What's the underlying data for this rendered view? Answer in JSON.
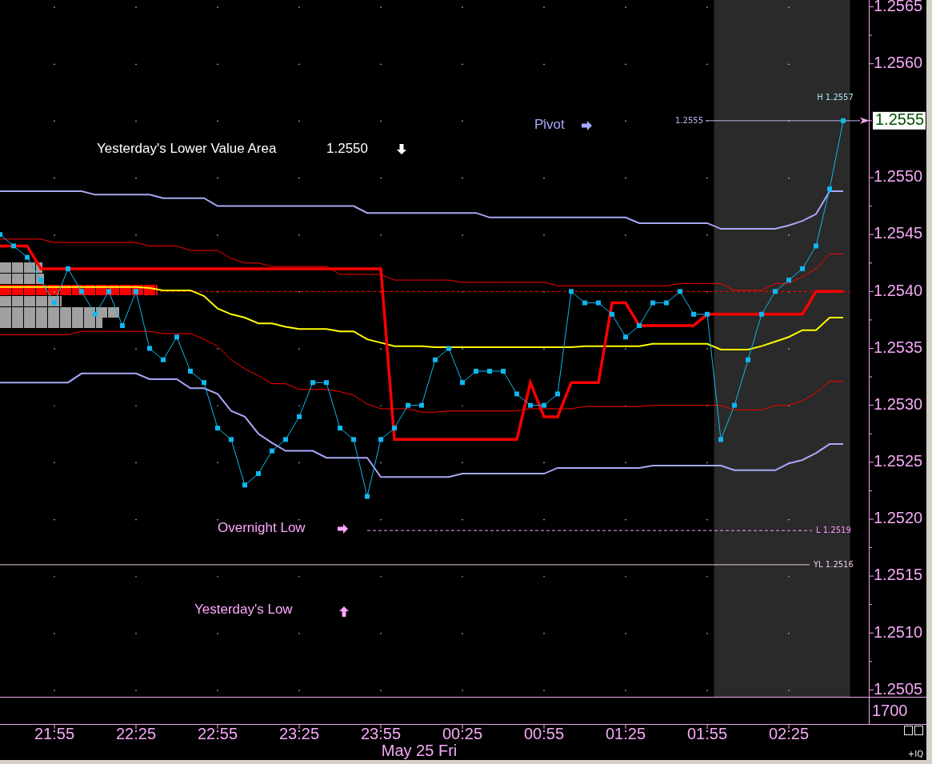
{
  "chart": {
    "chart_data": {
      "type": "line",
      "categories": [
        null,
        null,
        null,
        null,
        "21:55",
        null,
        null,
        null,
        null,
        null,
        "22:25",
        null,
        null,
        null,
        null,
        null,
        "22:55",
        null,
        null,
        null,
        null,
        null,
        "23:25",
        null,
        null,
        null,
        null,
        null,
        "23:55",
        null,
        null,
        null,
        null,
        null,
        "00:25",
        null,
        null,
        null,
        null,
        null,
        "00:55",
        null,
        null,
        null,
        null,
        null,
        "01:25",
        null,
        null,
        null,
        null,
        null,
        "01:55",
        null,
        null,
        null,
        null,
        null,
        "02:25",
        null,
        null,
        null,
        null
      ],
      "ylim": [
        1.25044,
        1.25656
      ],
      "grid": true,
      "yticks": [
        {
          "value": 1.2565,
          "label": "1.2565"
        },
        {
          "value": 1.256,
          "label": "1.2560"
        },
        {
          "value": 1.255,
          "label": "1.2550"
        },
        {
          "value": 1.2545,
          "label": "1.2545"
        },
        {
          "value": 1.254,
          "label": "1.2540"
        },
        {
          "value": 1.2535,
          "label": "1.2535"
        },
        {
          "value": 1.253,
          "label": "1.2530"
        },
        {
          "value": 1.2525,
          "label": "1.2525"
        },
        {
          "value": 1.252,
          "label": "1.2520"
        },
        {
          "value": 1.2515,
          "label": "1.2515"
        },
        {
          "value": 1.251,
          "label": "1.2510"
        },
        {
          "value": 1.2505,
          "label": "1.2505"
        }
      ],
      "series": [
        {
          "color": "#a8a8f8",
          "values": [
            1.25488,
            1.25488,
            1.25488,
            1.25488,
            1.25488,
            1.25488,
            1.25488,
            1.25485,
            1.25485,
            1.25485,
            1.25485,
            1.25485,
            1.25482,
            1.25482,
            1.25482,
            1.25482,
            1.25475,
            1.25475,
            1.25475,
            1.25475,
            1.25475,
            1.25475,
            1.25475,
            1.25475,
            1.25475,
            1.25475,
            1.25475,
            1.25469,
            1.25469,
            1.25469,
            1.25469,
            1.25469,
            1.25469,
            1.25469,
            1.25469,
            1.25469,
            1.25465,
            1.25465,
            1.25465,
            1.25465,
            1.25465,
            1.25465,
            1.25465,
            1.25465,
            1.25465,
            1.25465,
            1.25465,
            1.2546,
            1.2546,
            1.2546,
            1.2546,
            1.2546,
            1.2546,
            1.25455,
            1.25455,
            1.25455,
            1.25455,
            1.25455,
            1.25458,
            1.25462,
            1.25468,
            1.25488,
            1.25488
          ]
        },
        {
          "color": "#a8a8f8",
          "values": [
            1.2532,
            1.2532,
            1.2532,
            1.2532,
            1.2532,
            1.2532,
            1.25328,
            1.25328,
            1.25328,
            1.25328,
            1.25328,
            1.25323,
            1.25323,
            1.25323,
            1.25315,
            1.25315,
            1.2531,
            1.25295,
            1.2529,
            1.25275,
            1.25267,
            1.2526,
            1.2526,
            1.2526,
            1.25254,
            1.25254,
            1.25254,
            1.25254,
            1.25237,
            1.25237,
            1.25237,
            1.25237,
            1.25237,
            1.25237,
            1.2524,
            1.2524,
            1.2524,
            1.2524,
            1.2524,
            1.2524,
            1.2524,
            1.25245,
            1.25245,
            1.25245,
            1.25245,
            1.25245,
            1.25245,
            1.25245,
            1.25247,
            1.25247,
            1.25247,
            1.25247,
            1.25247,
            1.25247,
            1.25243,
            1.25243,
            1.25243,
            1.25243,
            1.25249,
            1.25252,
            1.25258,
            1.25266,
            1.25266
          ]
        },
        {
          "color": "#ff0000",
          "values": [
            1.25446,
            1.25446,
            1.25446,
            1.25446,
            1.25443,
            1.25443,
            1.25443,
            1.25443,
            1.25443,
            1.25443,
            1.25443,
            1.2544,
            1.2544,
            1.2544,
            1.25436,
            1.25436,
            1.25436,
            1.25429,
            1.25425,
            1.25425,
            1.25422,
            1.25422,
            1.25422,
            1.25422,
            1.25422,
            1.25415,
            1.25415,
            1.25415,
            1.25415,
            1.2541,
            1.2541,
            1.2541,
            1.2541,
            1.2541,
            1.25408,
            1.25408,
            1.25408,
            1.25408,
            1.25408,
            1.25408,
            1.25408,
            1.25405,
            1.25405,
            1.25405,
            1.25405,
            1.25405,
            1.25405,
            1.25405,
            1.25405,
            1.25405,
            1.25407,
            1.25407,
            1.25407,
            1.25407,
            1.25401,
            1.25401,
            1.25401,
            1.25407,
            1.25407,
            1.25413,
            1.2542,
            1.25433,
            1.25433
          ]
        },
        {
          "color": "#ff0000",
          "values": [
            1.25362,
            1.25362,
            1.25362,
            1.25362,
            1.25362,
            1.25362,
            1.25365,
            1.25365,
            1.25365,
            1.25365,
            1.25365,
            1.25365,
            1.25363,
            1.25363,
            1.25363,
            1.25358,
            1.25352,
            1.2534,
            1.25332,
            1.25326,
            1.25319,
            1.25319,
            1.25314,
            1.25314,
            1.25314,
            1.25312,
            1.25309,
            1.25301,
            1.25297,
            1.25297,
            1.25297,
            1.25294,
            1.25294,
            1.25295,
            1.25295,
            1.25295,
            1.25295,
            1.25295,
            1.25295,
            1.25297,
            1.25297,
            1.25297,
            1.25297,
            1.25299,
            1.25299,
            1.25299,
            1.25299,
            1.25299,
            1.253,
            1.253,
            1.253,
            1.253,
            1.253,
            1.253,
            1.25296,
            1.25296,
            1.25296,
            1.253,
            1.253,
            1.25304,
            1.25311,
            1.25321,
            1.25321
          ]
        },
        {
          "color": "#ffff00",
          "values": [
            1.25404,
            1.25404,
            1.25404,
            1.25404,
            1.25404,
            1.25404,
            1.25404,
            1.25404,
            1.25404,
            1.25404,
            1.25404,
            1.25403,
            1.25401,
            1.25401,
            1.25401,
            1.25396,
            1.25385,
            1.2538,
            1.25377,
            1.25372,
            1.25372,
            1.25369,
            1.25367,
            1.25367,
            1.25367,
            1.25365,
            1.25365,
            1.25358,
            1.25355,
            1.25352,
            1.25352,
            1.25352,
            1.25351,
            1.25351,
            1.25351,
            1.25351,
            1.25351,
            1.25351,
            1.25351,
            1.25351,
            1.25351,
            1.25351,
            1.25351,
            1.25352,
            1.25352,
            1.25352,
            1.25352,
            1.25352,
            1.25354,
            1.25354,
            1.25354,
            1.25354,
            1.25354,
            1.25349,
            1.25349,
            1.25349,
            1.25352,
            1.25356,
            1.2536,
            1.25366,
            1.25366,
            1.25377,
            1.25377
          ]
        },
        {
          "color": "#ff0000",
          "values": [
            1.2544,
            1.2544,
            1.2544,
            1.2542,
            1.2542,
            1.2542,
            1.2542,
            1.2542,
            1.2542,
            1.2542,
            1.2542,
            1.2542,
            1.2542,
            1.2542,
            1.2542,
            1.2542,
            1.2542,
            1.2542,
            1.2542,
            1.2542,
            1.2542,
            1.2542,
            1.2542,
            1.2542,
            1.2542,
            1.2542,
            1.2542,
            1.2542,
            1.2542,
            1.2527,
            1.2527,
            1.2527,
            1.2527,
            1.2527,
            1.2527,
            1.2527,
            1.2527,
            1.2527,
            1.2527,
            1.2532,
            1.2529,
            1.2529,
            1.2532,
            1.2532,
            1.2532,
            1.2539,
            1.2539,
            1.2537,
            1.2537,
            1.2537,
            1.2537,
            1.2537,
            1.2538,
            1.2538,
            1.2538,
            1.2538,
            1.2538,
            1.2538,
            1.2538,
            1.2538,
            1.254,
            1.254,
            1.254
          ]
        },
        {
          "color": "#10b8f0",
          "marker": "square",
          "values": [
            1.2545,
            1.2544,
            1.2543,
            1.2541,
            1.2539,
            1.2542,
            1.254,
            1.2538,
            1.254,
            1.2537,
            1.254,
            1.2535,
            1.2534,
            1.2536,
            1.2533,
            1.2532,
            1.2528,
            1.2527,
            1.2523,
            1.2524,
            1.2526,
            1.2527,
            1.2529,
            1.2532,
            1.2532,
            1.2528,
            1.2527,
            1.2522,
            1.2527,
            1.2528,
            1.253,
            1.253,
            1.2534,
            1.2535,
            1.2532,
            1.2533,
            1.2533,
            1.2533,
            1.2531,
            1.253,
            1.253,
            1.2531,
            1.254,
            1.2539,
            1.2539,
            1.2538,
            1.2536,
            1.2537,
            1.2539,
            1.2539,
            1.254,
            1.2538,
            1.2538,
            1.2527,
            1.253,
            1.2534,
            1.2538,
            1.254,
            1.2541,
            1.2542,
            1.2544,
            1.2549,
            1.2555
          ]
        }
      ],
      "ref_lines": [
        {
          "axis": "y",
          "value": 1.254
        },
        {
          "axis": "y",
          "value": 1.2555,
          "label": "1.2555"
        },
        {
          "axis": "y",
          "value": 1.2519,
          "label": "L 1.2519"
        },
        {
          "axis": "y",
          "value": 1.2516,
          "label": "YL 1.2516"
        }
      ],
      "annotations": [
        "H 1.2557",
        "Yesterday's Lower Value Area",
        "1.2550",
        "Pivot",
        "Overnight Low",
        "Yesterday's Low"
      ]
    }
  },
  "price_axis": {
    "last_price": "1.2555"
  },
  "volume_pane": {
    "axis_label": "1700"
  },
  "time_axis": {
    "date": "May 25 Fri"
  },
  "corner_label": "+IQ"
}
